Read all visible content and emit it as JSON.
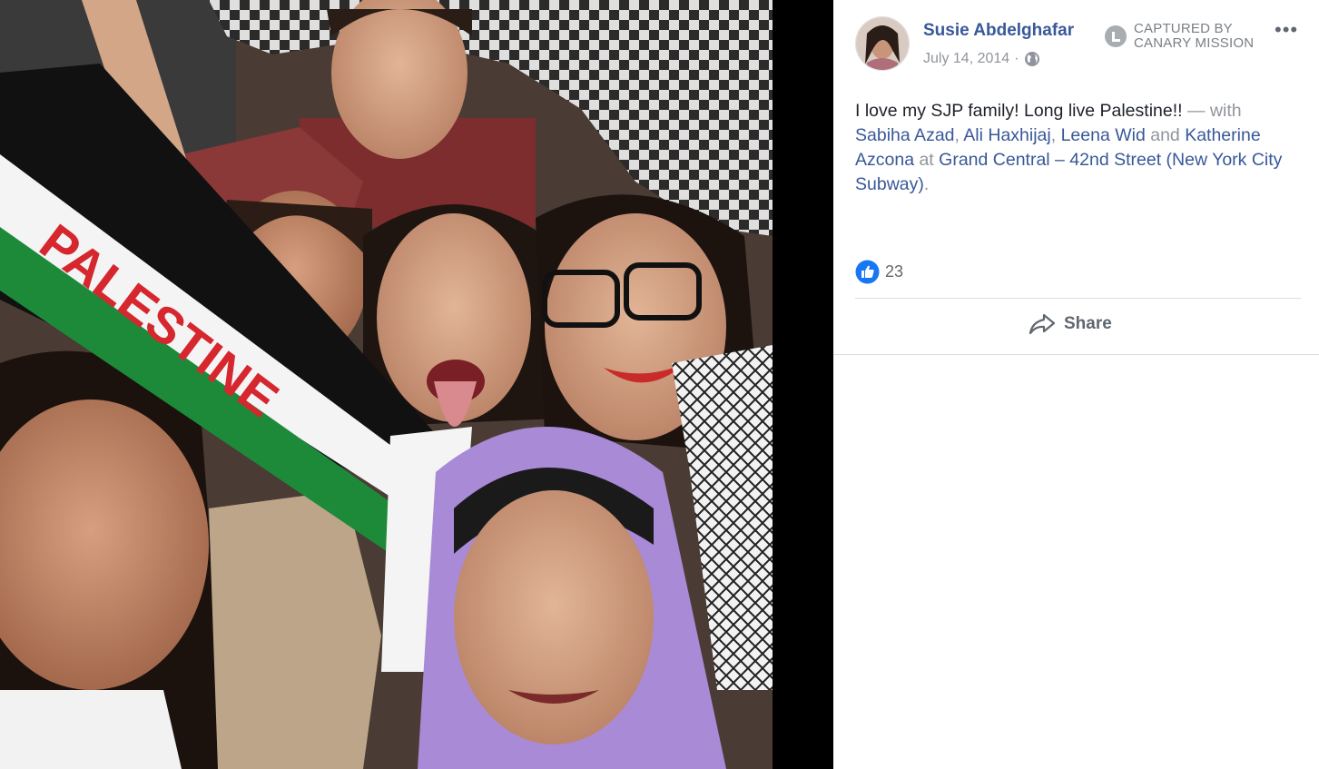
{
  "post": {
    "author_name": "Susie Abdelghafar",
    "date": "July 14, 2014",
    "separator": "·",
    "privacy_icon": "globe-icon",
    "more_label": "•••",
    "text_main": "I love my SJP family! Long live Palestine!!",
    "with_text": " — with ",
    "tags": [
      "Sabiha Azad",
      "Ali Haxhijaj",
      "Leena Wid",
      "Katherine Azcona"
    ],
    "comma": ", ",
    "and_text": " and ",
    "at_text": " at ",
    "location": "Grand Central – 42nd Street (New York City Subway)",
    "period": ".",
    "like_count": "23",
    "share_label": "Share"
  },
  "watermark": {
    "line1": "CAPTURED BY",
    "line2": "CANARY MISSION",
    "icon": "canary-mission-logo"
  },
  "photo": {
    "flag_text": "PALESTINE"
  },
  "colors": {
    "link": "#385898",
    "like_blue": "#1877f2",
    "text": "#1d2129",
    "muted": "#90949c"
  }
}
